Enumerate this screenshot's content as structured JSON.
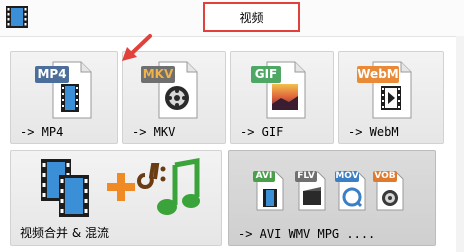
{
  "tab": {
    "label": "视频"
  },
  "tiles": [
    {
      "id": "mp4",
      "badge": "MP4",
      "badge_color": "#4b6f9a",
      "label": "-> MP4"
    },
    {
      "id": "mkv",
      "badge": "MKV",
      "badge_color": "#6f6f6f",
      "label": "-> MKV"
    },
    {
      "id": "gif",
      "badge": "GIF",
      "badge_color": "#4fa765",
      "label": "-> GIF"
    },
    {
      "id": "webm",
      "badge": "WebM",
      "badge_color": "#e98a38",
      "label": "-> WebM"
    }
  ],
  "merge_tile": {
    "label": "视频合并 & 混流"
  },
  "multi_tile": {
    "label": "-> AVI WMV MPG ....",
    "badges": [
      {
        "text": "AVI",
        "color": "#4aa04a"
      },
      {
        "text": "FLV",
        "color": "#707070"
      },
      {
        "text": "MOV",
        "color": "#3b7fc4"
      },
      {
        "text": "VOB",
        "color": "#e07a2e"
      }
    ]
  },
  "colors": {
    "highlight_border": "#e2413b",
    "arrow": "#e2413b"
  }
}
